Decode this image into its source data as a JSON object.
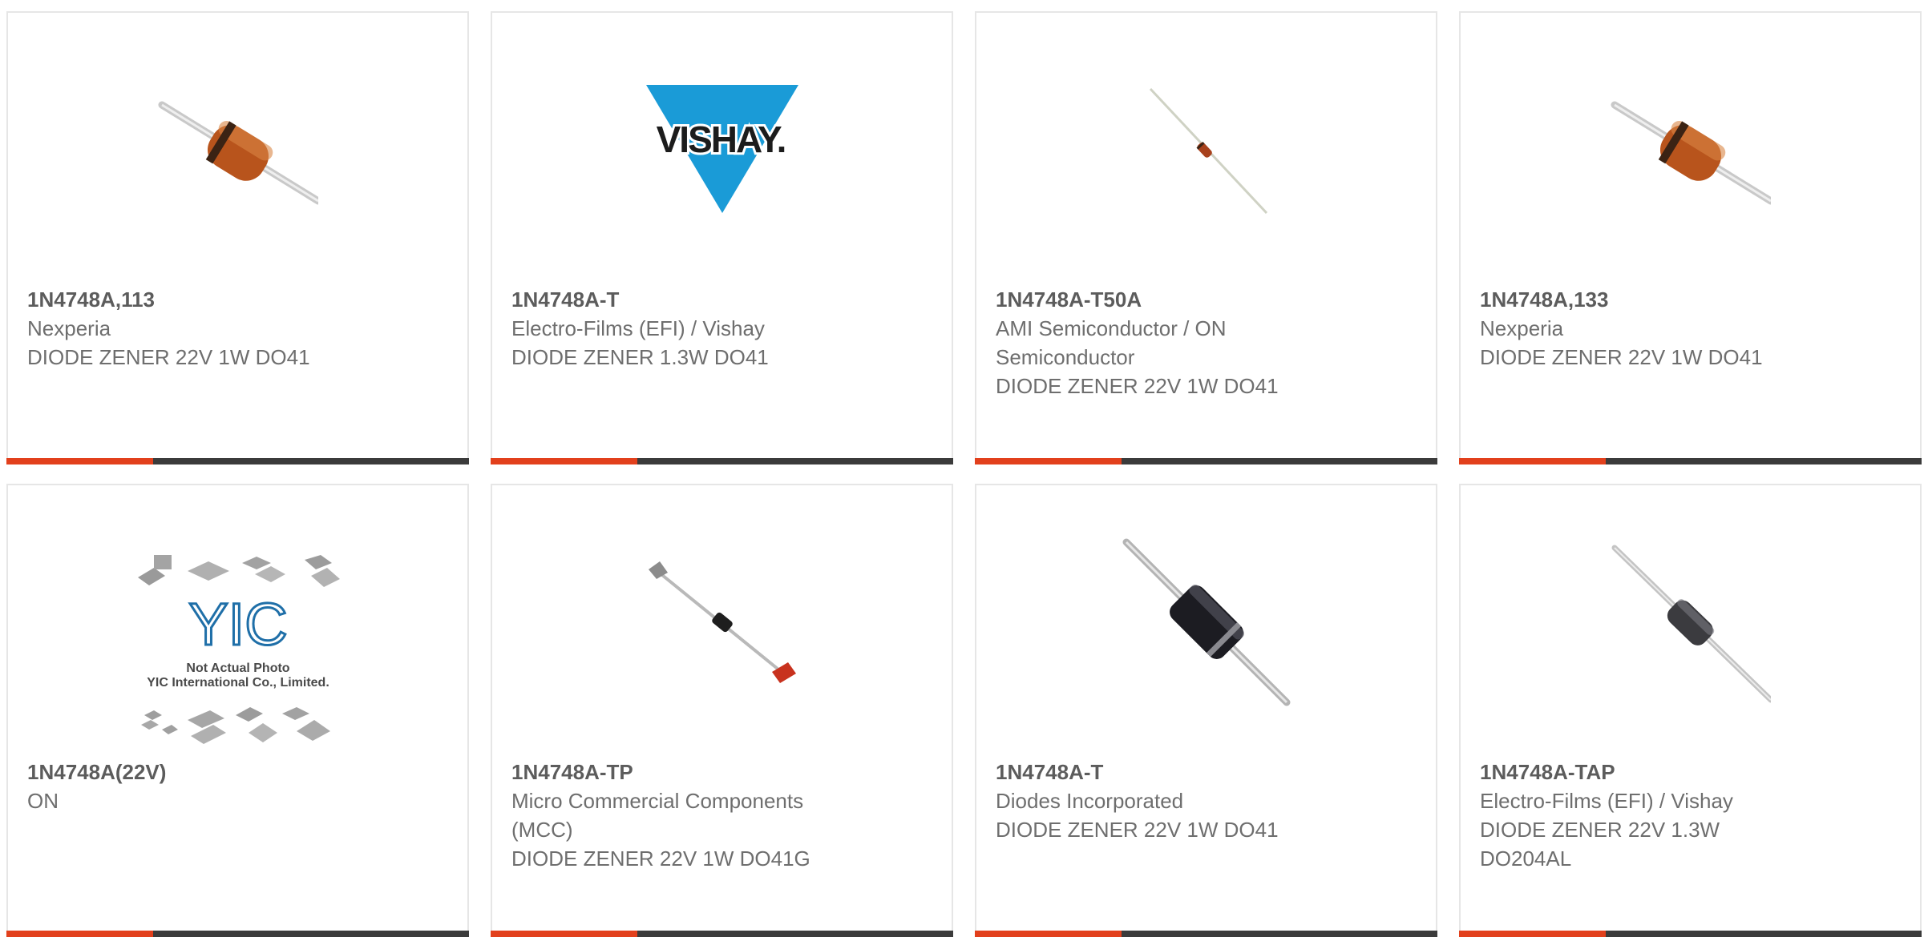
{
  "products": [
    {
      "part_number": "1N4748A,113",
      "manufacturer": "Nexperia",
      "description": "DIODE ZENER 22V 1W DO41",
      "image_icon": "orange-axial-diode-icon"
    },
    {
      "part_number": "1N4748A-T",
      "manufacturer": "Electro-Films (EFI) / Vishay",
      "description": "DIODE ZENER 1.3W DO41",
      "image_icon": "vishay-logo",
      "logo_text": "VISHAY."
    },
    {
      "part_number": "1N4748A-T50A",
      "manufacturer": "AMI Semiconductor / ON Semiconductor",
      "description": "DIODE ZENER 22V 1W DO41",
      "image_icon": "thin-lead-diode-icon"
    },
    {
      "part_number": "1N4748A,133",
      "manufacturer": "Nexperia",
      "description": "DIODE ZENER 22V 1W DO41",
      "image_icon": "orange-axial-diode-icon"
    },
    {
      "part_number": "1N4748A(22V)",
      "manufacturer": "ON",
      "description": "",
      "image_icon": "yic-placeholder",
      "placeholder_line1": "Not Actual Photo",
      "placeholder_line2": "YIC International Co., Limited.",
      "placeholder_logo": "YIC"
    },
    {
      "part_number": "1N4748A-TP",
      "manufacturer": "Micro Commercial Components (MCC)",
      "description": "DIODE ZENER 22V 1W DO41G",
      "image_icon": "taped-diode-icon"
    },
    {
      "part_number": "1N4748A-T",
      "manufacturer": "Diodes Incorporated",
      "description": "DIODE ZENER 22V 1W DO41",
      "image_icon": "black-axial-diode-icon"
    },
    {
      "part_number": "1N4748A-TAP",
      "manufacturer": "Electro-Films (EFI) / Vishay",
      "description": "DIODE ZENER 22V 1.3W DO204AL",
      "image_icon": "gray-axial-diode-icon"
    }
  ],
  "colors": {
    "accent": "#e2401c",
    "bar": "#3b3b3b",
    "border": "#e6e6e6",
    "text": "#666666",
    "vishay_blue": "#1a9bd7"
  }
}
